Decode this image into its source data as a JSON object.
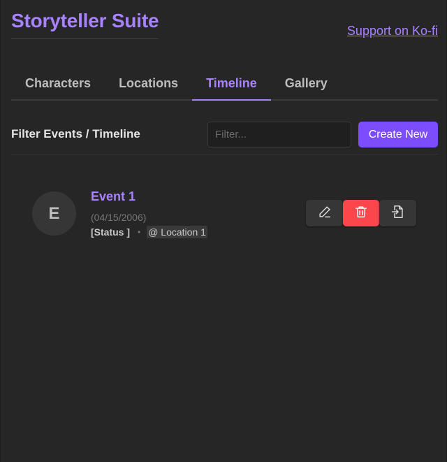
{
  "app": {
    "title": "Storyteller Suite",
    "support_link": "Support on Ko-fi"
  },
  "tabs": [
    {
      "label": "Characters",
      "active": false
    },
    {
      "label": "Locations",
      "active": false
    },
    {
      "label": "Timeline",
      "active": true
    },
    {
      "label": "Gallery",
      "active": false
    }
  ],
  "toolbar": {
    "title": "Filter Events / Timeline",
    "filter_placeholder": "Filter...",
    "filter_value": "",
    "create_label": "Create New"
  },
  "events": [
    {
      "avatar_letter": "E",
      "title": "Event 1",
      "date": "(04/15/2006)",
      "status": "[Status ]",
      "separator": "•",
      "location": "@ Location 1"
    }
  ],
  "icons": {
    "edit": "pencil-icon",
    "delete": "trash-icon",
    "open": "file-open-icon"
  },
  "colors": {
    "accent": "#a882ff",
    "button_primary": "#7c4dff",
    "danger": "#fb464c",
    "background": "#262626"
  }
}
